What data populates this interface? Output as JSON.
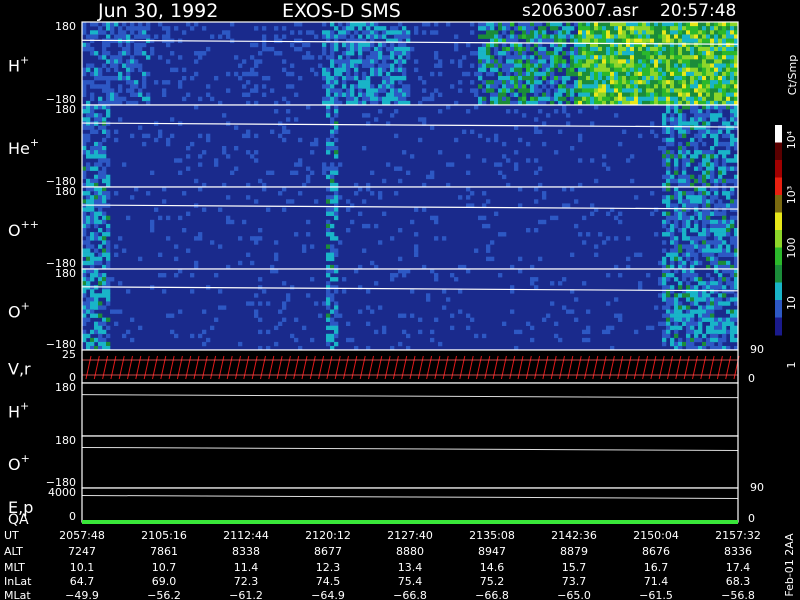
{
  "header": {
    "date": "Jun 30, 1992",
    "instrument": "EXOS-D SMS",
    "file": "s2063007.asr",
    "time": "20:57:48"
  },
  "side": {
    "colorbar_unit": "Ct/Smp",
    "colorbar_ticks": [
      "10⁴",
      "10³",
      "100",
      "10",
      "1"
    ],
    "right_ticks": [
      "90",
      "0",
      "90",
      "0"
    ],
    "vertical_note": "Feb-01 2AA"
  },
  "panels": [
    {
      "id": "h-plus",
      "label": "H",
      "sup": "+",
      "top": "180",
      "bottom": "−180",
      "kind": "spectrogram"
    },
    {
      "id": "he-plus",
      "label": "He",
      "sup": "+",
      "top": "180",
      "bottom": "−180",
      "kind": "spectrogram"
    },
    {
      "id": "o-plus-plus",
      "label": "O",
      "sup": "++",
      "top": "180",
      "bottom": "−180",
      "kind": "spectrogram"
    },
    {
      "id": "o-plus",
      "label": "O",
      "sup": "+",
      "top": "180",
      "bottom": "−180",
      "kind": "spectrogram"
    },
    {
      "id": "v-r",
      "label": "V,r",
      "sup": "",
      "top": "25",
      "bottom": "0",
      "kind": "line"
    },
    {
      "id": "h-plus-2",
      "label": "H",
      "sup": "+",
      "top": "180",
      "bottom": "",
      "kind": "empty"
    },
    {
      "id": "o-plus-2",
      "label": "O",
      "sup": "+",
      "top": "180",
      "bottom": "−180",
      "kind": "empty"
    },
    {
      "id": "e-p",
      "label": "E,p",
      "sup": "",
      "top": "4000",
      "bottom": "0",
      "kind": "empty"
    }
  ],
  "qa_label": "QA",
  "ephemeris": {
    "row_labels": [
      "UT",
      "ALT",
      "MLT",
      "InLat",
      "MLat"
    ],
    "columns": [
      [
        "2057:48",
        "7247",
        "10.1",
        "64.7",
        "−49.9"
      ],
      [
        "2105:16",
        "7861",
        "10.7",
        "69.0",
        "−56.2"
      ],
      [
        "2112:44",
        "8338",
        "11.4",
        "72.3",
        "−61.2"
      ],
      [
        "2120:12",
        "8677",
        "12.3",
        "74.5",
        "−64.9"
      ],
      [
        "2127:40",
        "8880",
        "13.4",
        "75.4",
        "−66.8"
      ],
      [
        "2135:08",
        "8947",
        "14.6",
        "75.2",
        "−66.8"
      ],
      [
        "2142:36",
        "8879",
        "15.7",
        "73.7",
        "−65.0"
      ],
      [
        "2150:04",
        "8676",
        "16.7",
        "71.4",
        "−61.5"
      ],
      [
        "2157:32",
        "8336",
        "17.4",
        "68.3",
        "−56.8"
      ]
    ]
  },
  "chart_data": {
    "type": "heatmap",
    "title": "Jun 30, 1992   EXOS-D SMS",
    "x_ticks": [
      "2057:48",
      "2105:16",
      "2112:44",
      "2120:12",
      "2127:40",
      "2135:08",
      "2142:36",
      "2150:04",
      "2157:32"
    ],
    "colorbar": {
      "label": "Ct/Smp",
      "scale": "log",
      "range": [
        1,
        10000
      ],
      "colors": [
        "#1a1a8c",
        "#2d58c4",
        "#19b4c8",
        "#1b8c3a",
        "#2bb82b",
        "#8ed62a",
        "#e8e81a",
        "#7a6a10",
        "#e82010",
        "#a00000",
        "#5a0000",
        "#ffffff"
      ]
    },
    "series": [
      {
        "name": "H+",
        "ylim": [
          -180,
          180
        ]
      },
      {
        "name": "He+",
        "ylim": [
          -180,
          180
        ]
      },
      {
        "name": "O++",
        "ylim": [
          -180,
          180
        ]
      },
      {
        "name": "O+",
        "ylim": [
          -180,
          180
        ]
      },
      {
        "name": "V,r",
        "ylim": [
          0,
          25
        ]
      },
      {
        "name": "E,p",
        "ylim": [
          0,
          4000
        ]
      }
    ]
  }
}
